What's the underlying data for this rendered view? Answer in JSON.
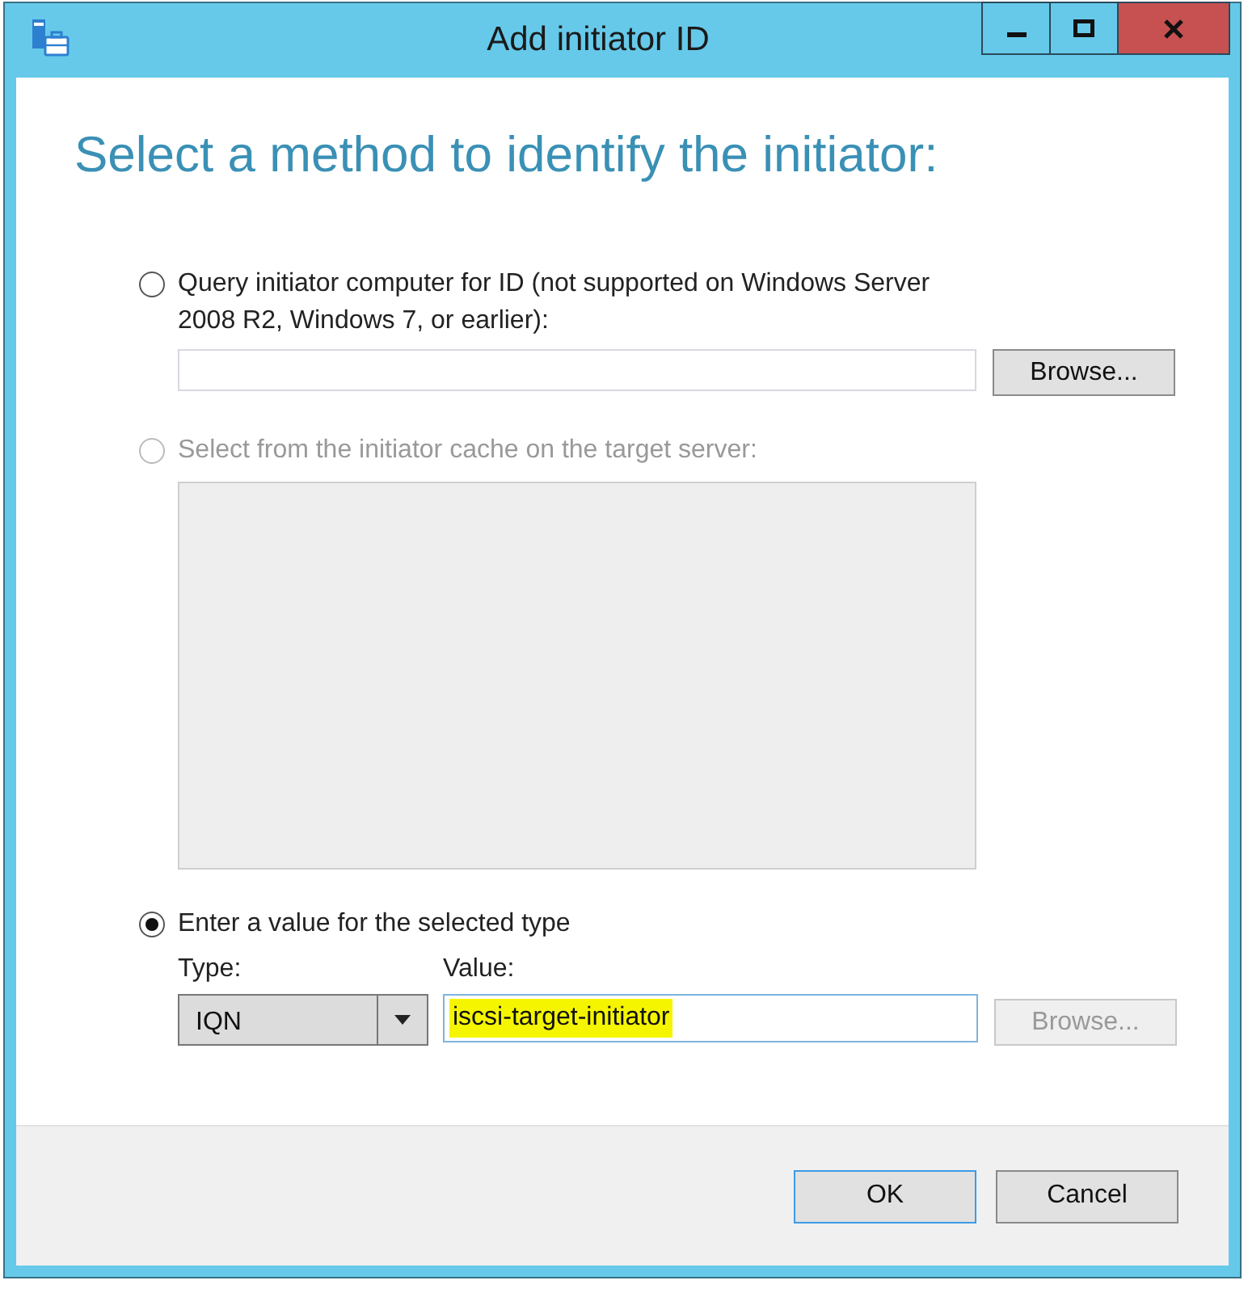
{
  "window": {
    "title": "Add initiator ID"
  },
  "heading": "Select a method to identify the initiator:",
  "options": [
    {
      "kind": "query",
      "label": "Query initiator computer for ID (not supported on Windows Server 2008 R2, Windows 7, or earlier):",
      "selected": false,
      "disabled": false,
      "browse": {
        "label": "Browse...",
        "disabled": false
      }
    },
    {
      "kind": "cache",
      "label": "Select from the initiator cache on the target server:",
      "selected": false,
      "disabled": true
    },
    {
      "kind": "value",
      "label": "Enter a value for the selected type",
      "selected": true,
      "disabled": false,
      "type_label": "Type:",
      "type_value": "IQN",
      "value_label": "Value:",
      "value": "iscsi-target-initiator",
      "highlighted": true,
      "browse": {
        "label": "Browse...",
        "disabled": true
      }
    }
  ],
  "buttons": [
    {
      "label": "OK",
      "default": true
    },
    {
      "label": "Cancel",
      "default": false
    }
  ]
}
